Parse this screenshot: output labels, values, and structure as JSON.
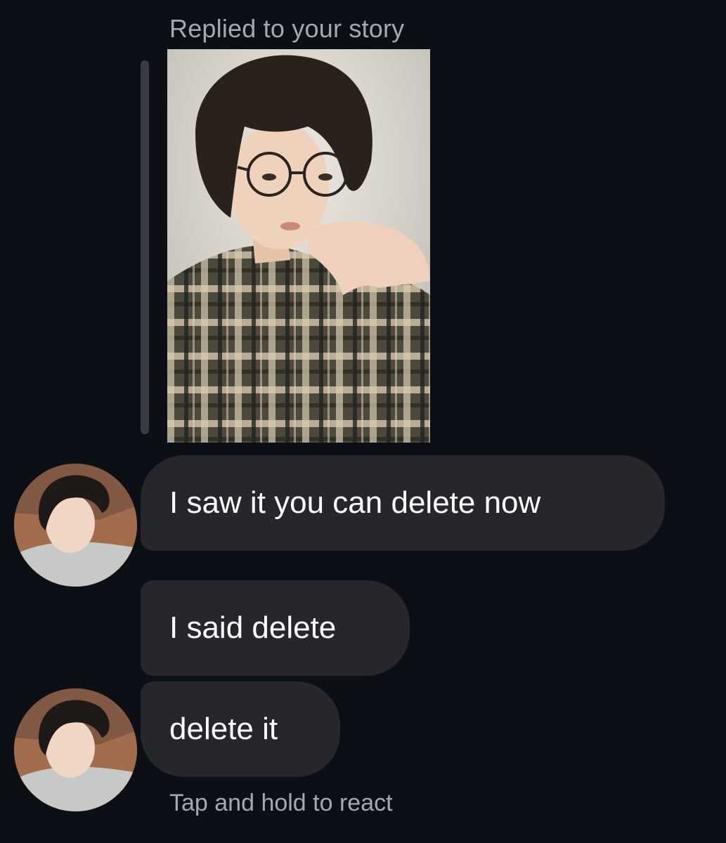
{
  "story_reply": {
    "label": "Replied to your story",
    "image": "story-photo"
  },
  "messages": [
    {
      "text": "I saw it you can delete now",
      "avatar": "sender-avatar"
    },
    {
      "text": "I said delete"
    },
    {
      "text": "delete it",
      "avatar": "sender-avatar"
    }
  ],
  "hint": "Tap and hold to react",
  "colors": {
    "background": "#0d0f16",
    "bubble": "#26272d",
    "secondary_text": "#a6a8b0",
    "reply_bar": "#3a3b41"
  }
}
